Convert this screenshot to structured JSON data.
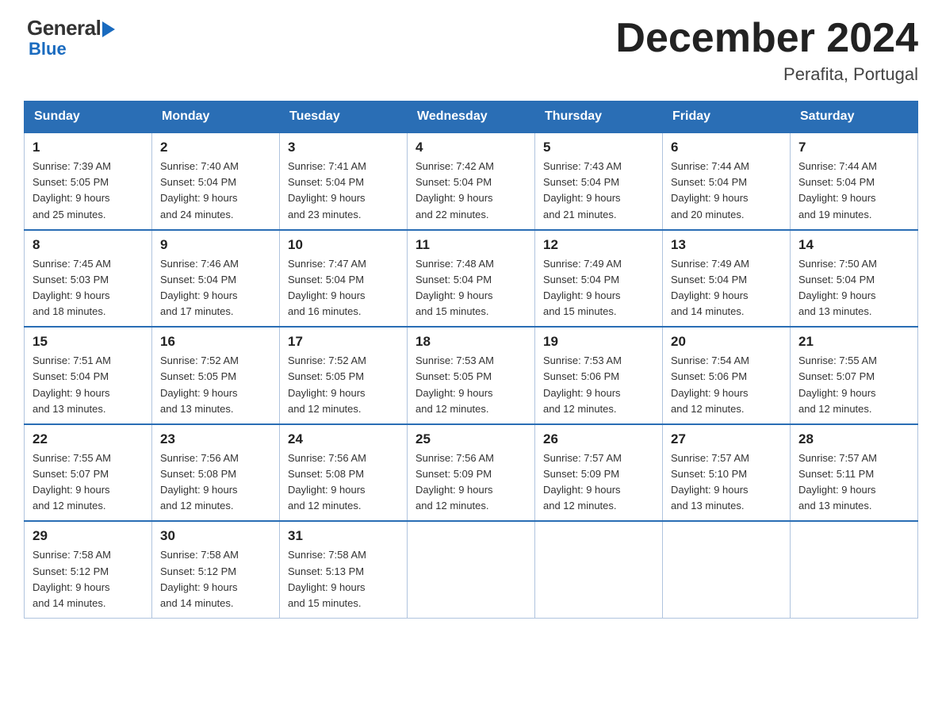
{
  "header": {
    "logo_general": "General",
    "logo_blue": "Blue",
    "month_title": "December 2024",
    "location": "Perafita, Portugal"
  },
  "weekdays": [
    "Sunday",
    "Monday",
    "Tuesday",
    "Wednesday",
    "Thursday",
    "Friday",
    "Saturday"
  ],
  "weeks": [
    [
      {
        "day": "1",
        "sunrise": "7:39 AM",
        "sunset": "5:05 PM",
        "daylight": "9 hours and 25 minutes."
      },
      {
        "day": "2",
        "sunrise": "7:40 AM",
        "sunset": "5:04 PM",
        "daylight": "9 hours and 24 minutes."
      },
      {
        "day": "3",
        "sunrise": "7:41 AM",
        "sunset": "5:04 PM",
        "daylight": "9 hours and 23 minutes."
      },
      {
        "day": "4",
        "sunrise": "7:42 AM",
        "sunset": "5:04 PM",
        "daylight": "9 hours and 22 minutes."
      },
      {
        "day": "5",
        "sunrise": "7:43 AM",
        "sunset": "5:04 PM",
        "daylight": "9 hours and 21 minutes."
      },
      {
        "day": "6",
        "sunrise": "7:44 AM",
        "sunset": "5:04 PM",
        "daylight": "9 hours and 20 minutes."
      },
      {
        "day": "7",
        "sunrise": "7:44 AM",
        "sunset": "5:04 PM",
        "daylight": "9 hours and 19 minutes."
      }
    ],
    [
      {
        "day": "8",
        "sunrise": "7:45 AM",
        "sunset": "5:03 PM",
        "daylight": "9 hours and 18 minutes."
      },
      {
        "day": "9",
        "sunrise": "7:46 AM",
        "sunset": "5:04 PM",
        "daylight": "9 hours and 17 minutes."
      },
      {
        "day": "10",
        "sunrise": "7:47 AM",
        "sunset": "5:04 PM",
        "daylight": "9 hours and 16 minutes."
      },
      {
        "day": "11",
        "sunrise": "7:48 AM",
        "sunset": "5:04 PM",
        "daylight": "9 hours and 15 minutes."
      },
      {
        "day": "12",
        "sunrise": "7:49 AM",
        "sunset": "5:04 PM",
        "daylight": "9 hours and 15 minutes."
      },
      {
        "day": "13",
        "sunrise": "7:49 AM",
        "sunset": "5:04 PM",
        "daylight": "9 hours and 14 minutes."
      },
      {
        "day": "14",
        "sunrise": "7:50 AM",
        "sunset": "5:04 PM",
        "daylight": "9 hours and 13 minutes."
      }
    ],
    [
      {
        "day": "15",
        "sunrise": "7:51 AM",
        "sunset": "5:04 PM",
        "daylight": "9 hours and 13 minutes."
      },
      {
        "day": "16",
        "sunrise": "7:52 AM",
        "sunset": "5:05 PM",
        "daylight": "9 hours and 13 minutes."
      },
      {
        "day": "17",
        "sunrise": "7:52 AM",
        "sunset": "5:05 PM",
        "daylight": "9 hours and 12 minutes."
      },
      {
        "day": "18",
        "sunrise": "7:53 AM",
        "sunset": "5:05 PM",
        "daylight": "9 hours and 12 minutes."
      },
      {
        "day": "19",
        "sunrise": "7:53 AM",
        "sunset": "5:06 PM",
        "daylight": "9 hours and 12 minutes."
      },
      {
        "day": "20",
        "sunrise": "7:54 AM",
        "sunset": "5:06 PM",
        "daylight": "9 hours and 12 minutes."
      },
      {
        "day": "21",
        "sunrise": "7:55 AM",
        "sunset": "5:07 PM",
        "daylight": "9 hours and 12 minutes."
      }
    ],
    [
      {
        "day": "22",
        "sunrise": "7:55 AM",
        "sunset": "5:07 PM",
        "daylight": "9 hours and 12 minutes."
      },
      {
        "day": "23",
        "sunrise": "7:56 AM",
        "sunset": "5:08 PM",
        "daylight": "9 hours and 12 minutes."
      },
      {
        "day": "24",
        "sunrise": "7:56 AM",
        "sunset": "5:08 PM",
        "daylight": "9 hours and 12 minutes."
      },
      {
        "day": "25",
        "sunrise": "7:56 AM",
        "sunset": "5:09 PM",
        "daylight": "9 hours and 12 minutes."
      },
      {
        "day": "26",
        "sunrise": "7:57 AM",
        "sunset": "5:09 PM",
        "daylight": "9 hours and 12 minutes."
      },
      {
        "day": "27",
        "sunrise": "7:57 AM",
        "sunset": "5:10 PM",
        "daylight": "9 hours and 13 minutes."
      },
      {
        "day": "28",
        "sunrise": "7:57 AM",
        "sunset": "5:11 PM",
        "daylight": "9 hours and 13 minutes."
      }
    ],
    [
      {
        "day": "29",
        "sunrise": "7:58 AM",
        "sunset": "5:12 PM",
        "daylight": "9 hours and 14 minutes."
      },
      {
        "day": "30",
        "sunrise": "7:58 AM",
        "sunset": "5:12 PM",
        "daylight": "9 hours and 14 minutes."
      },
      {
        "day": "31",
        "sunrise": "7:58 AM",
        "sunset": "5:13 PM",
        "daylight": "9 hours and 15 minutes."
      },
      null,
      null,
      null,
      null
    ]
  ]
}
